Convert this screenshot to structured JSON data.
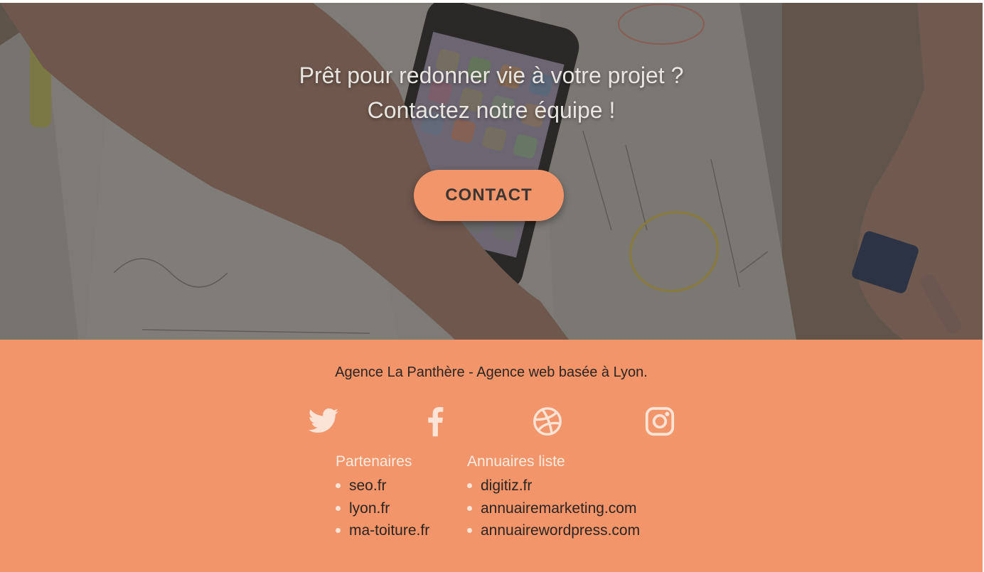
{
  "hero": {
    "headline_line1": "Prêt pour redonner vie à votre projet ?",
    "headline_line2": "Contactez notre équipe !",
    "cta_label": "CONTACT"
  },
  "footer": {
    "agency_text": "Agence La Panthère - Agence web basée à Lyon.",
    "social": [
      {
        "icon": "twitter-icon"
      },
      {
        "icon": "facebook-icon"
      },
      {
        "icon": "dribbble-icon"
      },
      {
        "icon": "instagram-icon"
      }
    ],
    "partners": {
      "title": "Partenaires",
      "items": [
        "seo.fr",
        "lyon.fr",
        "ma-toiture.fr"
      ]
    },
    "directories": {
      "title": "Annuaires liste",
      "items": [
        "digitiz.fr",
        "annuairemarketing.com",
        "annuairewordpress.com"
      ]
    }
  },
  "colors": {
    "accent": "#f3956b",
    "footer_bg": "#f3956b",
    "text_dark": "#2b2522",
    "icon_light": "#fbe3d5"
  }
}
